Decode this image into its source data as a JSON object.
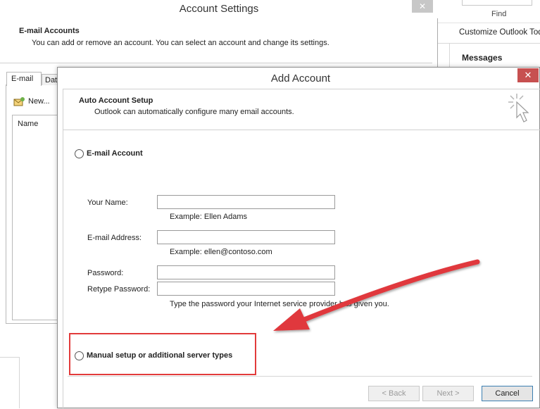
{
  "outlook": {
    "find_label": "Find",
    "customize_label": "Customize Outlook Toda",
    "messages_label": "Messages"
  },
  "account_settings": {
    "title": "Account Settings",
    "close_glyph": "✕",
    "header_title": "E-mail Accounts",
    "header_desc": "You can add or remove an account. You can select an account and change its settings.",
    "tab_email": "E-mail",
    "tab_data": "Data Files",
    "new_button": "New...",
    "column_name": "Name"
  },
  "add_account": {
    "title": "Add Account",
    "close_glyph": "✕",
    "header_title": "Auto Account Setup",
    "header_desc": "Outlook can automatically configure many email accounts.",
    "email_account_option": "E-mail Account",
    "your_name_label": "Your Name:",
    "your_name_hint": "Example: Ellen Adams",
    "email_label": "E-mail Address:",
    "email_hint": "Example: ellen@contoso.com",
    "password_label": "Password:",
    "retype_label": "Retype Password:",
    "password_hint": "Type the password your Internet service provider has given you.",
    "manual_option": "Manual setup or additional server types",
    "back_button": "< Back",
    "next_button": "Next >",
    "cancel_button": "Cancel"
  },
  "colors": {
    "highlight": "#e23b3b",
    "close_red": "#c75050"
  }
}
